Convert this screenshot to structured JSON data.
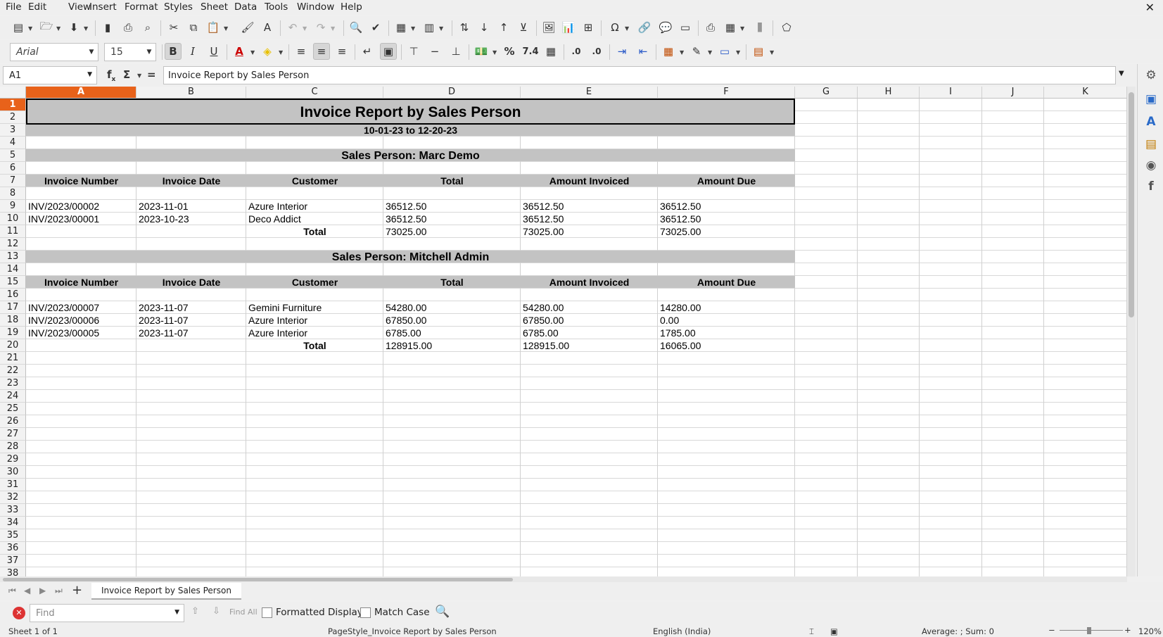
{
  "menu": [
    "File",
    "Edit",
    "View",
    "Insert",
    "Format",
    "Styles",
    "Sheet",
    "Data",
    "Tools",
    "Window",
    "Help"
  ],
  "font": {
    "name": "Arial",
    "size": "15"
  },
  "formula_bar": {
    "cell_ref": "A1",
    "content": "Invoice Report by Sales Person"
  },
  "columns": [
    "A",
    "B",
    "C",
    "D",
    "E",
    "F",
    "G",
    "H",
    "I",
    "J",
    "K"
  ],
  "selected_column": "A",
  "rows_count": 38,
  "selected_row": 1,
  "report": {
    "title": "Invoice Report by Sales Person",
    "date_range": "10-01-23 to 12-20-23",
    "sections": [
      {
        "heading": "Sales Person: Marc Demo",
        "headers": [
          "Invoice Number",
          "Invoice Date",
          "Customer",
          "Total",
          "Amount Invoiced",
          "Amount Due"
        ],
        "rows": [
          [
            "INV/2023/00002",
            "2023-11-01",
            "Azure Interior",
            "36512.50",
            "36512.50",
            "36512.50"
          ],
          [
            "INV/2023/00001",
            "2023-10-23",
            "Deco Addict",
            "36512.50",
            "36512.50",
            "36512.50"
          ]
        ],
        "total_label": "Total",
        "totals": [
          "73025.00",
          "73025.00",
          "73025.00"
        ]
      },
      {
        "heading": "Sales Person: Mitchell Admin",
        "headers": [
          "Invoice Number",
          "Invoice Date",
          "Customer",
          "Total",
          "Amount Invoiced",
          "Amount Due"
        ],
        "rows": [
          [
            "INV/2023/00007",
            "2023-11-07",
            "Gemini Furniture",
            "54280.00",
            "54280.00",
            "14280.00"
          ],
          [
            "INV/2023/00006",
            "2023-11-07",
            "Azure Interior",
            "67850.00",
            "67850.00",
            "0.00"
          ],
          [
            "INV/2023/00005",
            "2023-11-07",
            "Azure Interior",
            "6785.00",
            "6785.00",
            "1785.00"
          ]
        ],
        "total_label": "Total",
        "totals": [
          "128915.00",
          "128915.00",
          "16065.00"
        ]
      }
    ]
  },
  "sheet_tab": "Invoice Report by Sales Person",
  "find": {
    "placeholder": "Find",
    "find_all": "Find All",
    "formatted_display": "Formatted Display",
    "match_case": "Match Case"
  },
  "status": {
    "sheet": "Sheet 1 of 1",
    "page_style": "PageStyle_Invoice Report by Sales Person",
    "language": "English (India)",
    "summary": "Average: ; Sum: 0",
    "zoom": "120%"
  }
}
